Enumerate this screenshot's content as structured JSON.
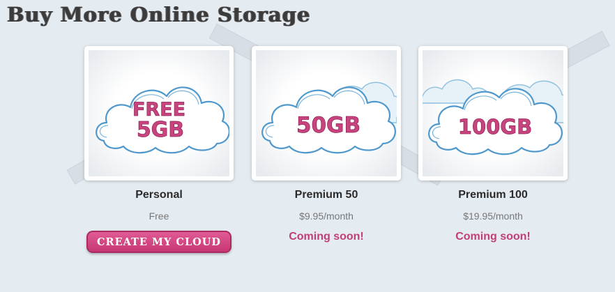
{
  "page": {
    "title": "Buy More Online Storage"
  },
  "colors": {
    "background": "#e4ebf1",
    "accent_pink": "#c33d77",
    "cloud_outline": "#4f98cc"
  },
  "plans": [
    {
      "name": "Personal",
      "price": "Free",
      "image": {
        "icon": "cloud-icon",
        "line1": "FREE",
        "line2": "5GB"
      },
      "action": {
        "label": "CREATE MY CLOUD"
      }
    },
    {
      "name": "Premium 50",
      "price": "$9.95/month",
      "image": {
        "icon": "cloud-icon",
        "text": "50GB"
      },
      "status": "Coming soon!"
    },
    {
      "name": "Premium 100",
      "price": "$19.95/month",
      "image": {
        "icon": "cloud-icon",
        "text": "100GB"
      },
      "status": "Coming soon!"
    }
  ]
}
